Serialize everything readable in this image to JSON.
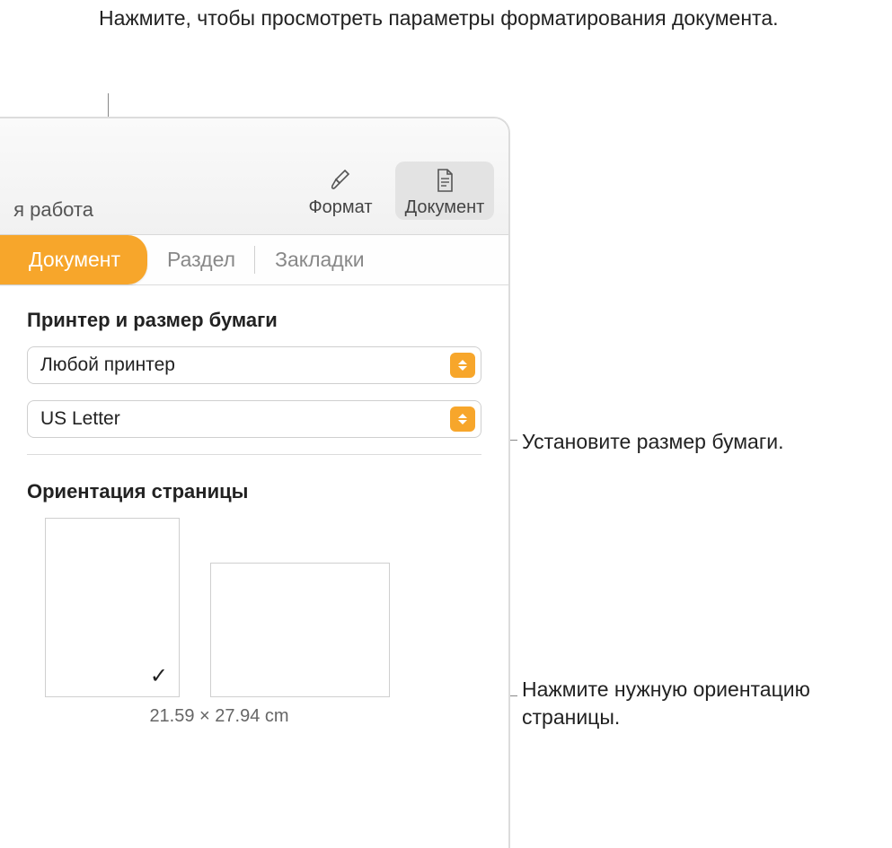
{
  "callouts": {
    "top": "Нажмите, чтобы просмотреть параметры форматирования документа.",
    "right1": "Установите размер бумаги.",
    "right2": "Нажмите нужную ориентацию страницы."
  },
  "toolbar": {
    "left_fragment": "я работа",
    "format_label": "Формат",
    "document_label": "Документ"
  },
  "tabs": {
    "document": "Документ",
    "section": "Раздел",
    "bookmarks": "Закладки"
  },
  "printer_section": {
    "title": "Принтер и размер бумаги",
    "printer_value": "Любой принтер",
    "paper_value": "US Letter"
  },
  "orientation_section": {
    "title": "Ориентация страницы",
    "checkmark": "✓",
    "size_caption": "21.59 × 27.94 cm"
  }
}
